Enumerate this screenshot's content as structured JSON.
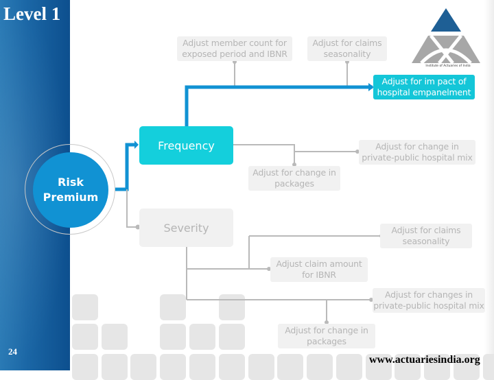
{
  "slide": {
    "title": "Level 1",
    "page_number": "24",
    "website": "www.actuariesindia.org"
  },
  "logo": {
    "caption": "Institute of Actuaries of India",
    "colors": {
      "triangle_top": "#1e5f95",
      "triangle_base": "#a7a7a7"
    }
  },
  "diagram": {
    "root": "Risk\nPremium",
    "root_lines": [
      "Risk",
      "Premium"
    ],
    "frequency": {
      "label": "Frequency",
      "adjustments": [
        "Adjust member count for exposed period and IBNR",
        "Adjust for claims seasonality",
        "Adjust for impact of hospital empanelment",
        "Adjust for change in private-public hospital mix",
        "Adjust for change in packages"
      ],
      "adjustment_lines": [
        [
          "Adjust member count for",
          "exposed period and IBNR"
        ],
        [
          "Adjust for claims",
          "seasonality"
        ],
        [
          "Adjust for im pact of",
          "hospital empanelment"
        ],
        [
          "Adjust for change in",
          "private-public hospital mix"
        ],
        [
          "Adjust for change in",
          "packages"
        ]
      ],
      "highlighted_index": 2
    },
    "severity": {
      "label": "Severity",
      "adjustment_lines": [
        [
          "Adjust for claims",
          "seasonality"
        ],
        [
          "Adjust claim amount",
          "for IBNR"
        ],
        [
          "Adjust for changes in",
          "private-public hospital mix"
        ],
        [
          "Adjust for change in",
          "packages"
        ]
      ]
    }
  },
  "colors": {
    "band": "#1a66a5",
    "accent_blue": "#1192d3",
    "accent_cyan": "#14c6d8",
    "inactive_box": "#f1f1f1",
    "inactive_text": "#b5b5b5",
    "connector_grey": "#b9b9b9"
  }
}
